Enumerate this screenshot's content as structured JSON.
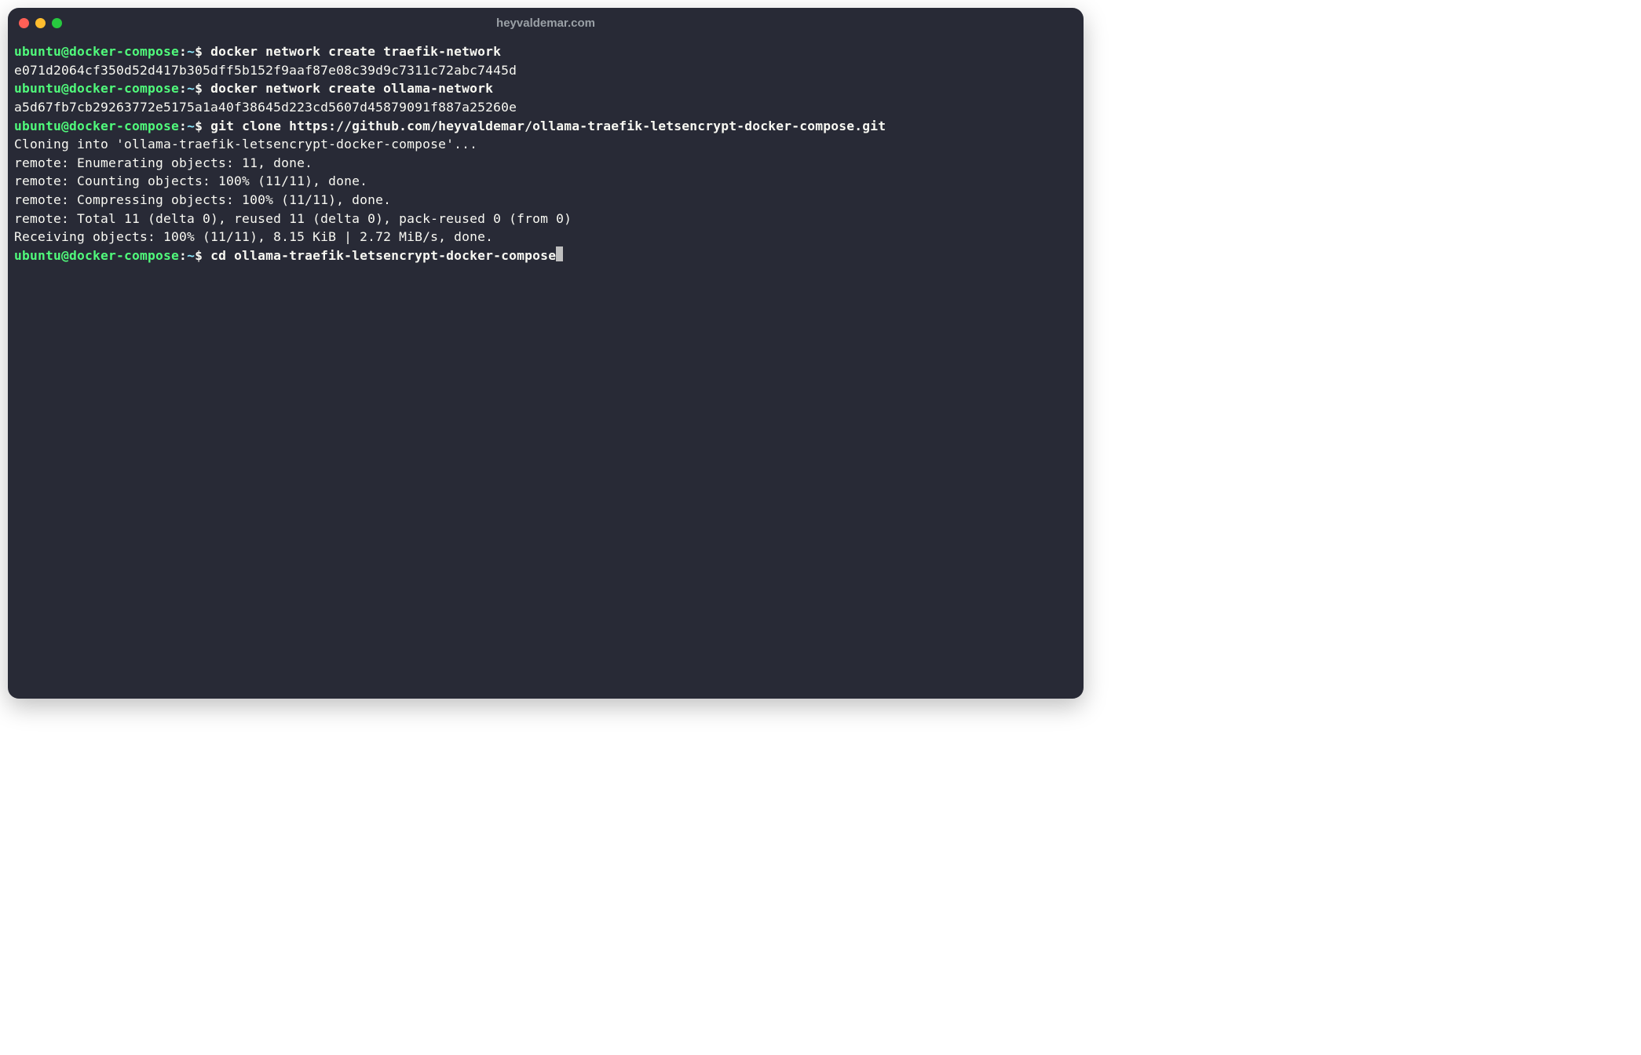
{
  "window": {
    "title": "heyvaldemar.com"
  },
  "prompt": {
    "user_host": "ubuntu@docker-compose",
    "colon": ":",
    "path": "~",
    "dollar": "$"
  },
  "lines": {
    "cmd1": " docker network create traefik-network",
    "out1": "e071d2064cf350d52d417b305dff5b152f9aaf87e08c39d9c7311c72abc7445d",
    "cmd2": " docker network create ollama-network",
    "out2": "a5d67fb7cb29263772e5175a1a40f38645d223cd5607d45879091f887a25260e",
    "cmd3": " git clone https://github.com/heyvaldemar/ollama-traefik-letsencrypt-docker-compose.git",
    "out3": "Cloning into 'ollama-traefik-letsencrypt-docker-compose'...",
    "out4": "remote: Enumerating objects: 11, done.",
    "out5": "remote: Counting objects: 100% (11/11), done.",
    "out6": "remote: Compressing objects: 100% (11/11), done.",
    "out7": "remote: Total 11 (delta 0), reused 11 (delta 0), pack-reused 0 (from 0)",
    "out8": "Receiving objects: 100% (11/11), 8.15 KiB | 2.72 MiB/s, done.",
    "cmd4": " cd ollama-traefik-letsencrypt-docker-compose"
  }
}
